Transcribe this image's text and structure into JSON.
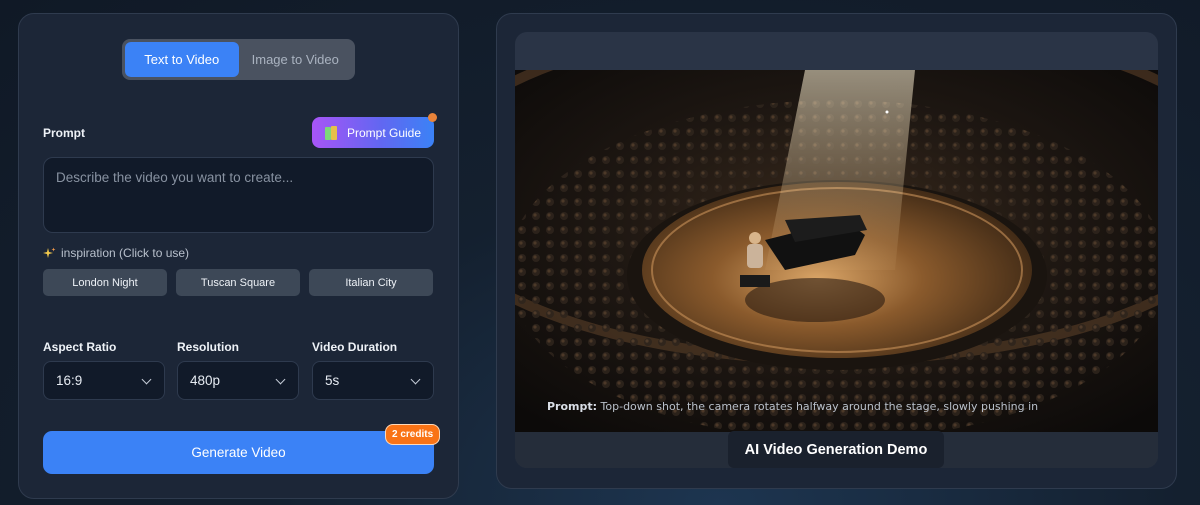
{
  "mode_toggle": {
    "text_to_video": "Text to Video",
    "image_to_video": "Image to Video",
    "active": "text_to_video"
  },
  "prompt": {
    "label": "Prompt",
    "guide_button": "Prompt Guide",
    "placeholder": "Describe the video you want to create...",
    "value": ""
  },
  "inspiration": {
    "label": "inspiration (Click to use)",
    "chips": [
      "London Night",
      "Tuscan Square",
      "Italian City"
    ]
  },
  "settings": {
    "aspect_ratio": {
      "label": "Aspect Ratio",
      "value": "16:9"
    },
    "resolution": {
      "label": "Resolution",
      "value": "480p"
    },
    "duration": {
      "label": "Video Duration",
      "value": "5s"
    }
  },
  "generate": {
    "label": "Generate Video",
    "credits": "2 credits"
  },
  "demo": {
    "caption_label": "Prompt:",
    "caption_text": "Top-down shot, the camera rotates halfway around the stage, slowly pushing in",
    "title": "AI Video Generation Demo"
  },
  "colors": {
    "accent": "#3b82f6",
    "credits_badge": "#f97316",
    "panel": "#1c2637"
  },
  "icons": [
    "book-icon",
    "sparkle-icon",
    "chevron-down-icon"
  ]
}
